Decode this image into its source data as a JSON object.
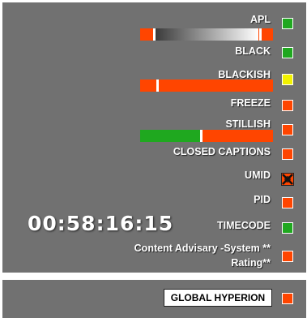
{
  "colors": {
    "panel_bg": "#717171",
    "green": "#1fa81f",
    "orange_red": "#ff4500",
    "yellow": "#f2f200",
    "white": "#ffffff"
  },
  "indicators": [
    {
      "label": "APL",
      "status": "green"
    },
    {
      "label": "BLACK",
      "status": "green"
    },
    {
      "label": "BLACKISH",
      "status": "yellow"
    },
    {
      "label": "FREEZE",
      "status": "red"
    },
    {
      "label": "STILLISH",
      "status": "red"
    },
    {
      "label": "CLOSED CAPTIONS",
      "status": "red"
    },
    {
      "label": "UMID",
      "status": "disabled"
    },
    {
      "label": "PID",
      "status": "red"
    },
    {
      "label": "TIMECODE",
      "status": "green"
    },
    {
      "label": "Content Advisary -System **",
      "label2": "Rating**",
      "status": "red"
    }
  ],
  "bars": {
    "apl": {
      "marker": 0.1
    },
    "blackish": {
      "marker": 0.12
    },
    "stillish": {
      "split": 0.45,
      "marker": 0.45
    }
  },
  "timecode": {
    "value": "00:58:16:15"
  },
  "global": {
    "label": "GLOBAL HYPERION",
    "status": "red"
  }
}
